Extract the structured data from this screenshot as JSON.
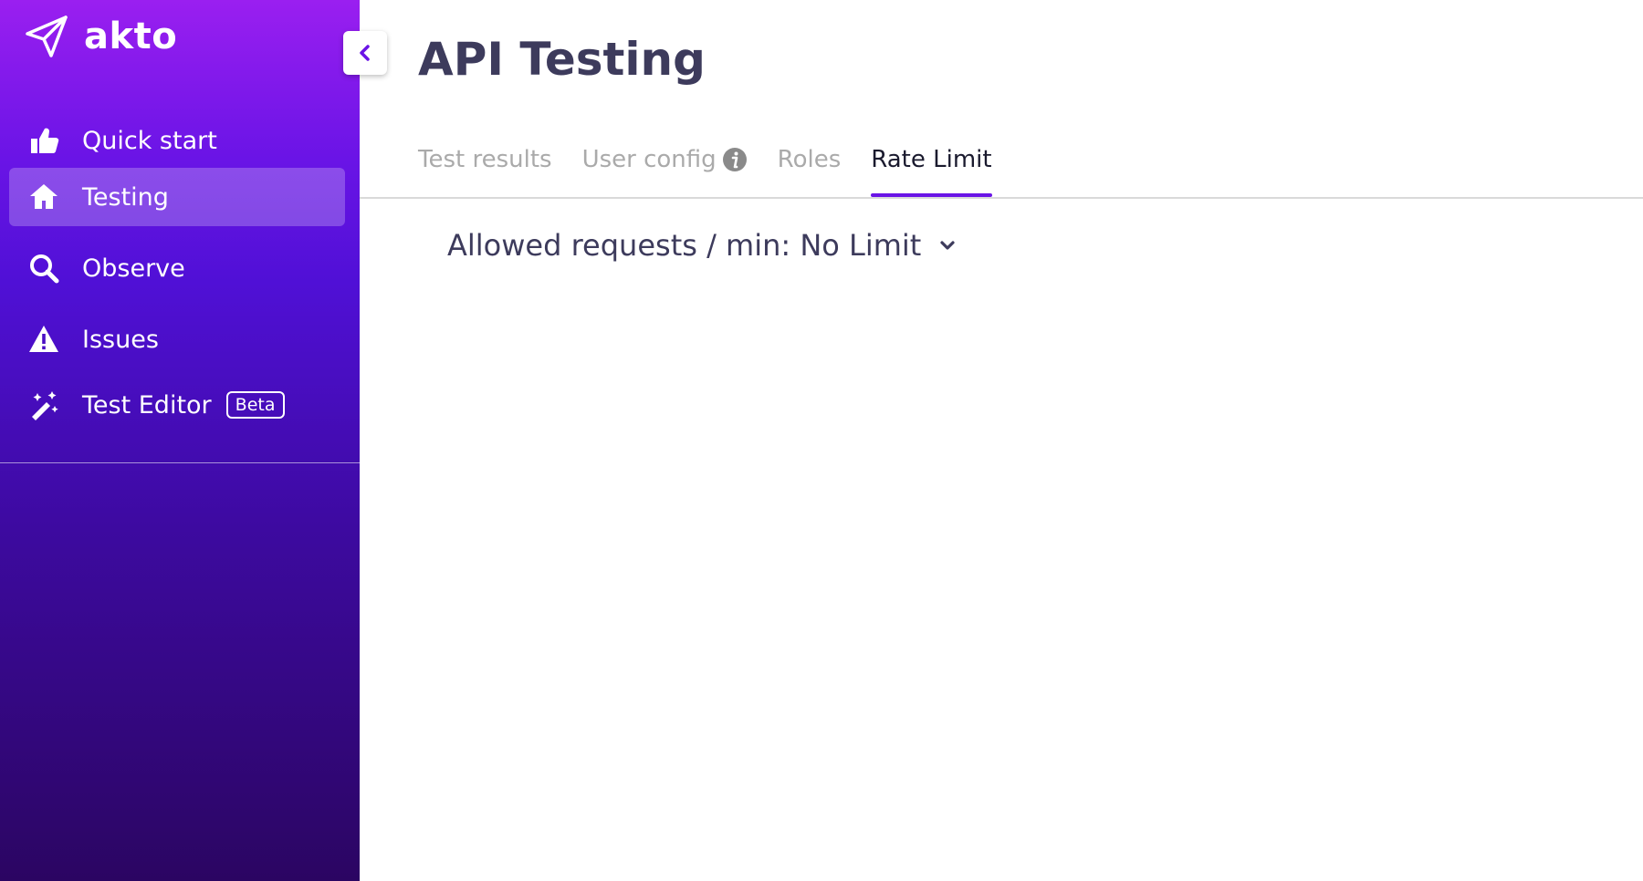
{
  "app": {
    "logo_text": "akto",
    "logo_icon": "paper-plane-icon"
  },
  "sidebar": {
    "items": [
      {
        "label": "Quick start",
        "icon": "thumbs-up-icon",
        "active": false
      },
      {
        "label": "Testing",
        "icon": "home-icon",
        "active": true
      },
      {
        "label": "Observe",
        "icon": "search-icon",
        "active": false
      },
      {
        "label": "Issues",
        "icon": "warning-icon",
        "active": false
      },
      {
        "label": "Test Editor",
        "icon": "magic-wand-icon",
        "active": false,
        "badge": "Beta"
      }
    ],
    "collapse_icon": "chevron-left-icon"
  },
  "main": {
    "title": "API Testing",
    "tabs": [
      {
        "label": "Test results",
        "active": false
      },
      {
        "label": "User config",
        "active": false,
        "icon": "info-icon"
      },
      {
        "label": "Roles",
        "active": false
      },
      {
        "label": "Rate Limit",
        "active": true
      }
    ],
    "rate_limit": {
      "label": "Allowed requests / min: No Limit",
      "icon": "chevron-down-icon"
    }
  },
  "colors": {
    "accent": "#6a14e6",
    "sidebar_top": "#9a1ff0",
    "sidebar_bottom": "#2b0562",
    "title_text": "#3d3b5c",
    "inactive_tab": "#aaaaaa"
  }
}
